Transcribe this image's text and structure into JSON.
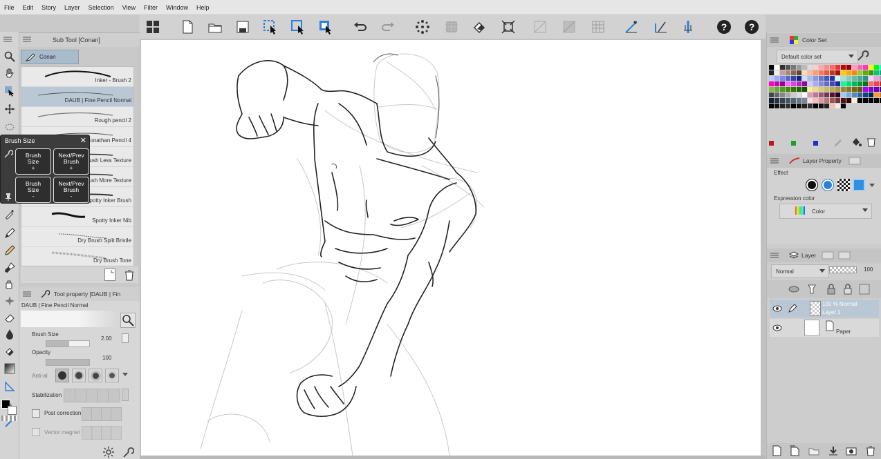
{
  "menu": [
    "File",
    "Edit",
    "Story",
    "Layer",
    "Selection",
    "View",
    "Filter",
    "Window",
    "Help"
  ],
  "subtool": {
    "header": "Sub Tool [Conan]",
    "tab": "Conan",
    "brushes": [
      {
        "name": "Inker - Brush 2",
        "selected": false
      },
      {
        "name": "DAUB | Fine Pencil Normal",
        "selected": true
      },
      {
        "name": "Rough pencil 2",
        "selected": false
      },
      {
        "name": "Jonathan Pencil 4",
        "selected": false
      },
      {
        "name": "rush Less Texture",
        "selected": false
      },
      {
        "name": "rush More Texture",
        "selected": false
      },
      {
        "name": "Spotty Inker Brush",
        "selected": false
      },
      {
        "name": "Spotty Inker Nib",
        "selected": false
      },
      {
        "name": "Dry Brush Split Bristle",
        "selected": false
      },
      {
        "name": "Dry Brush Tone",
        "selected": false
      }
    ]
  },
  "popup": {
    "title": "Brush Size",
    "buttons": [
      {
        "line1": "Brush",
        "line2": "Size",
        "line3": "+"
      },
      {
        "line1": "Next/Prev",
        "line2": "Brush",
        "line3": "+"
      },
      {
        "line1": "Brush",
        "line2": "Size",
        "line3": "-"
      },
      {
        "line1": "Next/Prev",
        "line2": "Brush",
        "line3": "-"
      }
    ]
  },
  "tool_property": {
    "header": "Tool property [DAUB | Fin",
    "preset": "DAUB | Fine Pencil Normal",
    "brush_size_label": "Brush Size",
    "brush_size_value": "2.00",
    "opacity_label": "Opacity",
    "opacity_value": "100",
    "antialias_label": "Anti-al",
    "stabilization_label": "Stabilization",
    "post_correction_label": "Post correction",
    "vector_magnet_label": "Vector magnet"
  },
  "color_set": {
    "header": "Color Set",
    "set_name": "Default color set"
  },
  "layer_property": {
    "header": "Layer Property",
    "effect_label": "Effect",
    "expression_label": "Expression color",
    "expression_value": "Color"
  },
  "layer_panel": {
    "header": "Layer",
    "blend_mode": "Normal",
    "opacity": "100",
    "layers": [
      {
        "line1": "100 %  Normal",
        "line2": "Layer 1",
        "selected": true
      },
      {
        "line1": "",
        "line2": "Paper",
        "selected": false
      }
    ]
  },
  "colors": {
    "accent": "#2f7fd6",
    "selected_row": "#b9c8d4"
  }
}
